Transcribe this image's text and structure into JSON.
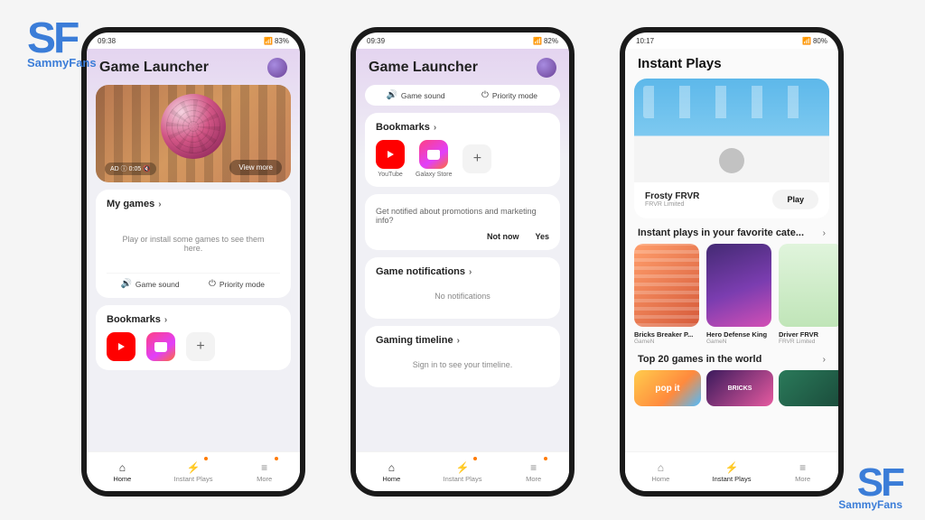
{
  "watermark": {
    "logo": "SF",
    "tagline": "SammyFans"
  },
  "phone1": {
    "status": {
      "time": "09:38",
      "battery": "83%"
    },
    "title": "Game Launcher",
    "banner": {
      "ad_text": "AD ⓘ  0:05 🔇",
      "view_more": "View more"
    },
    "my_games": {
      "title": "My games",
      "empty": "Play or install some games to see them here."
    },
    "quick": {
      "sound": "Game sound",
      "priority": "Priority mode"
    },
    "bookmarks": {
      "title": "Bookmarks"
    },
    "nav": {
      "home": "Home",
      "instant": "Instant Plays",
      "more": "More"
    }
  },
  "phone2": {
    "status": {
      "time": "09:39",
      "battery": "82%"
    },
    "title": "Game Launcher",
    "quick": {
      "sound": "Game sound",
      "priority": "Priority mode"
    },
    "bookmarks": {
      "title": "Bookmarks",
      "items": [
        {
          "label": "YouTube"
        },
        {
          "label": "Galaxy Store"
        }
      ]
    },
    "promo": {
      "text": "Get notified about promotions and marketing info?",
      "no": "Not now",
      "yes": "Yes"
    },
    "notif": {
      "title": "Game notifications",
      "empty": "No notifications"
    },
    "timeline": {
      "title": "Gaming timeline",
      "empty": "Sign in to see your timeline."
    },
    "nav": {
      "home": "Home",
      "instant": "Instant Plays",
      "more": "More"
    }
  },
  "phone3": {
    "status": {
      "time": "10:17",
      "battery": "80%"
    },
    "title": "Instant Plays",
    "featured": {
      "title": "Frosty FRVR",
      "publisher": "FRVR Limited",
      "play": "Play"
    },
    "categories": {
      "title": "Instant plays in your favorite cate...",
      "games": [
        {
          "title": "Bricks Breaker P...",
          "pub": "GameN"
        },
        {
          "title": "Hero Defense King",
          "pub": "GameN"
        },
        {
          "title": "Driver FRVR",
          "pub": "FRVR Limited"
        }
      ]
    },
    "top20": {
      "title": "Top 20 games in the world",
      "tiles": [
        "pop it",
        "BRICKS"
      ]
    },
    "nav": {
      "home": "Home",
      "instant": "Instant Plays",
      "more": "More"
    }
  }
}
